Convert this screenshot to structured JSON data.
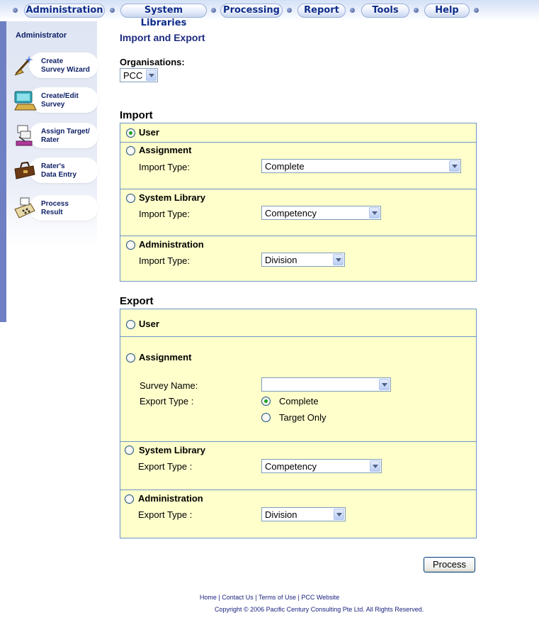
{
  "nav": {
    "tabs": [
      "Administration",
      "System Libraries",
      "Processing",
      "Report",
      "Tools",
      "Help"
    ]
  },
  "sidebar": {
    "title": "Administrator",
    "items": [
      {
        "line1": "Create",
        "line2": "Survey Wizard",
        "icon": "wand-icon"
      },
      {
        "line1": "Create/Edit",
        "line2": "Survey",
        "icon": "computer-icon"
      },
      {
        "line1": "Assign Target/",
        "line2": "Rater",
        "icon": "papers-icon"
      },
      {
        "line1": "Rater's",
        "line2": "Data Entry",
        "icon": "briefcase-icon"
      },
      {
        "line1": "Process",
        "line2": "Result",
        "icon": "calculator-icon"
      }
    ]
  },
  "page": {
    "title": "Import and Export",
    "org_label": "Organisations:",
    "org_value": "PCC"
  },
  "import": {
    "title": "Import",
    "user_label": "User",
    "assignment_label": "Assignment",
    "assignment_type_label": "Import Type:",
    "assignment_type_value": "Complete",
    "syslib_label": "System Library",
    "syslib_type_label": "Import Type:",
    "syslib_type_value": "Competency",
    "admin_label": "Administration",
    "admin_type_label": "Import Type:",
    "admin_type_value": "Division"
  },
  "export": {
    "title": "Export",
    "user_label": "User",
    "assignment_label": "Assignment",
    "survey_name_label": "Survey Name:",
    "survey_name_value": "",
    "export_type_label": "Export Type :",
    "complete_label": "Complete",
    "target_only_label": "Target Only",
    "syslib_label": "System Library",
    "syslib_type_label": "Export Type :",
    "syslib_type_value": "Competency",
    "admin_label": "Administration",
    "admin_type_label": "Export Type :",
    "admin_type_value": "Division"
  },
  "actions": {
    "process_label": "Process"
  },
  "footer": {
    "links": [
      "Home",
      "Contact Us",
      "Terms of Use",
      "PCC Website"
    ],
    "copyright": "Copyright © 2006 Pacific Century Consulting Pte Ltd. All Rights Reserved."
  },
  "colors": {
    "panel_bg": "#ffffcc",
    "panel_border": "#6b95c8",
    "nav_text": "#0d2c8a",
    "radio_checked": "#21a121"
  }
}
